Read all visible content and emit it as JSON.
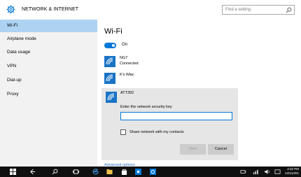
{
  "header": {
    "title": "NETWORK & INTERNET",
    "search_placeholder": "Find a setting",
    "search_icon": "search-icon",
    "gear_icon": "gear-icon"
  },
  "sidebar": {
    "items": [
      {
        "label": "Wi-Fi",
        "active": true
      },
      {
        "label": "Airplane mode"
      },
      {
        "label": "Data usage"
      },
      {
        "label": "VPN"
      },
      {
        "label": "Dial-up"
      },
      {
        "label": "Proxy"
      }
    ]
  },
  "main": {
    "title": "Wi-Fi",
    "toggle_label": "On",
    "networks": [
      {
        "name": "NG7",
        "status": "Connected"
      },
      {
        "name": "K's iMac",
        "status": ""
      }
    ],
    "expanded_network": {
      "name": "ATT392",
      "key_label": "Enter the network security key",
      "key_value": "",
      "share_label": "Share network with my contacts",
      "next_label": "Next",
      "cancel_label": "Cancel"
    },
    "advanced_link": "Advanced options"
  },
  "taskbar": {
    "clock_time": "3:32 PM",
    "clock_date": "12/21/201",
    "accent": "#0078d7"
  }
}
